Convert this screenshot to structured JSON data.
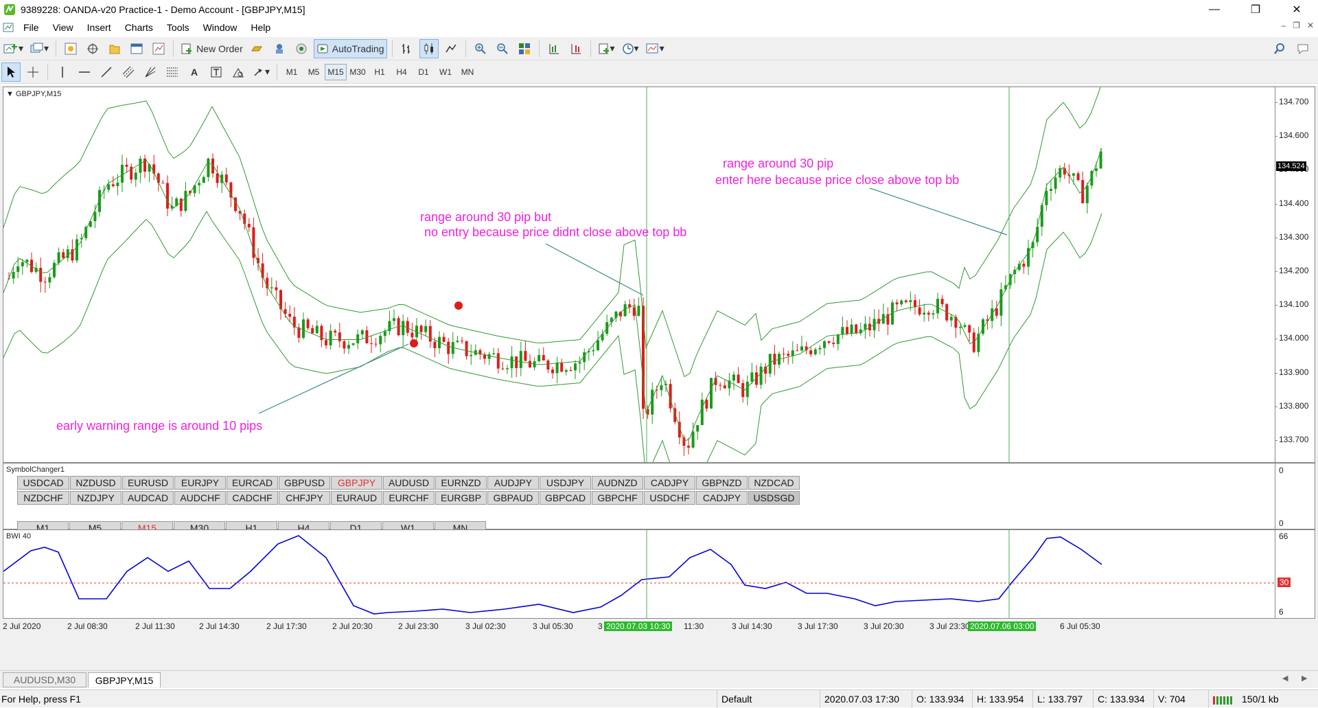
{
  "window": {
    "title": "9389228: OANDA-v20 Practice-1 - Demo Account - [GBPJPY,M15]"
  },
  "menu": [
    "File",
    "View",
    "Insert",
    "Charts",
    "Tools",
    "Window",
    "Help"
  ],
  "toolbar": {
    "new_order": "New Order",
    "autotrading": "AutoTrading"
  },
  "timeframes": [
    "M1",
    "M5",
    "M15",
    "M30",
    "H1",
    "H4",
    "D1",
    "W1",
    "MN"
  ],
  "selected_timeframe": "M15",
  "chart": {
    "label": "GBPJPY,M15",
    "price_ticks": [
      "134.700",
      "134.600",
      "134.500",
      "134.400",
      "134.300",
      "134.200",
      "134.100",
      "134.000",
      "133.900",
      "133.800",
      "133.700"
    ],
    "current_price": "134.524",
    "annotations": {
      "a1_l1": "range around 30 pip",
      "a1_l2": "enter here because price close above top bb",
      "a2_l1": "range around 30 pip but",
      "a2_l2": "no entry because price didnt close above top bb",
      "a3": "early warning range is around 10 pips"
    }
  },
  "symbol_panel": {
    "label": "SymbolChanger1",
    "row1": [
      "USDCAD",
      "NZDUSD",
      "EURUSD",
      "EURJPY",
      "EURCAD",
      "GBPUSD",
      "GBPJPY",
      "AUDUSD",
      "EURNZD",
      "AUDJPY",
      "USDJPY",
      "AUDNZD",
      "CADJPY",
      "GBPNZD",
      "NZDCAD"
    ],
    "row2": [
      "NZDCHF",
      "NZDJPY",
      "AUDCAD",
      "AUDCHF",
      "CADCHF",
      "CHFJPY",
      "EURAUD",
      "EURCHF",
      "EURGBP",
      "GBPAUD",
      "GBPCAD",
      "GBPCHF",
      "USDCHF",
      "CADJPY",
      "USDSGD"
    ],
    "active_symbol": "GBPJPY",
    "timeframes": [
      "M1",
      "M5",
      "M15",
      "M30",
      "H1",
      "H4",
      "D1",
      "W1",
      "MN"
    ],
    "scale_top": "0",
    "scale_bottom": "0"
  },
  "indicator": {
    "label": "BWI 40",
    "scale_top": "66",
    "level": "30",
    "scale_bottom": "6"
  },
  "time_axis": [
    "2 Jul 2020",
    "2 Jul 08:30",
    "2 Jul 11:30",
    "2 Jul 14:30",
    "2 Jul 17:30",
    "2 Jul 20:30",
    "2 Jul 23:30",
    "3 Jul 02:30",
    "3 Jul 05:30",
    "3",
    "11:30",
    "3 Jul 14:30",
    "3 Jul 17:30",
    "3 Jul 20:30",
    "3 Jul 23:30",
    "6 Jul 05:30"
  ],
  "vline_labels": [
    "2020.07.03 10:30",
    "2020.07.06 03:00"
  ],
  "tabs": [
    "AUDUSD,M30",
    "GBPJPY,M15"
  ],
  "active_tab": "GBPJPY,M15",
  "status": {
    "help": "For Help, press F1",
    "profile": "Default",
    "datetime": "2020.07.03 17:30",
    "open": "O: 133.934",
    "high": "H: 133.954",
    "low": "L: 133.797",
    "close": "C: 133.934",
    "volume": "V: 704",
    "traffic": "150/1 kb"
  },
  "colors": {
    "bull": "#1a9b1a",
    "bear": "#e01b1b",
    "bands": "#2f9a2f",
    "bwi": "#0000d8",
    "level": "#e53030",
    "annotation": "#ee22dd"
  }
}
